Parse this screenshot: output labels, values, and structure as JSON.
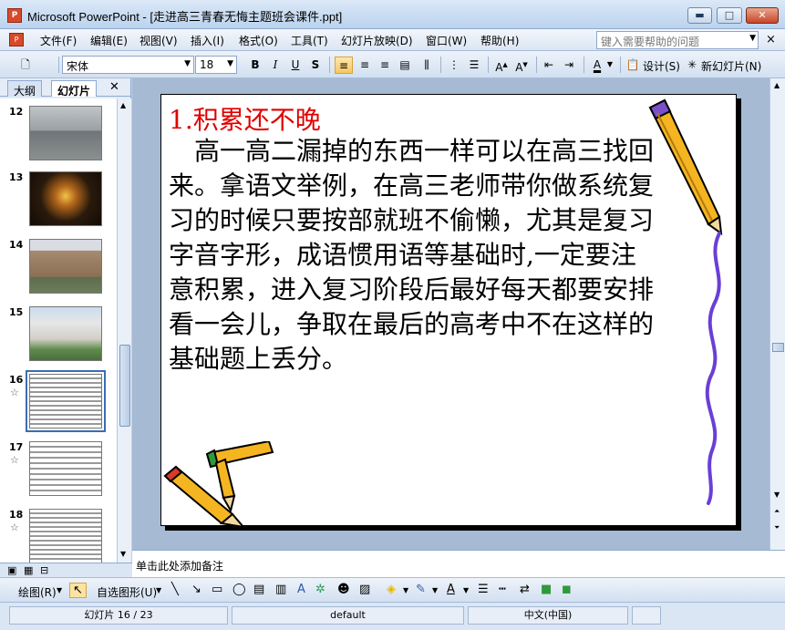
{
  "window": {
    "title": "Microsoft PowerPoint - [走进高三青春无悔主题班会课件.ppt]",
    "app_icon_letter": "P",
    "minimize": "▬",
    "maximize": "□",
    "close": "✕"
  },
  "menu": {
    "items": [
      "文件(F)",
      "编辑(E)",
      "视图(V)",
      "插入(I)",
      "格式(O)",
      "工具(T)",
      "幻灯片放映(D)",
      "窗口(W)",
      "帮助(H)"
    ],
    "help_placeholder": "键入需要帮助的问题",
    "doc_close": "×"
  },
  "format_toolbar": {
    "font_name": "宋体",
    "font_size": "18",
    "bold": "B",
    "italic": "I",
    "underline": "U",
    "shadow": "S",
    "design_label": "设计(S)",
    "new_slide_label": "新幻灯片(N)"
  },
  "left_pane": {
    "tabs": [
      "大纲",
      "幻灯片"
    ],
    "active_tab": "幻灯片",
    "close": "✕",
    "thumbnails": [
      {
        "number": "12",
        "star": "",
        "kind": "photo-gate"
      },
      {
        "number": "13",
        "star": "",
        "kind": "photo-night"
      },
      {
        "number": "14",
        "star": "",
        "kind": "photo-building"
      },
      {
        "number": "15",
        "star": "",
        "kind": "photo-campus"
      },
      {
        "number": "16",
        "star": "☆",
        "kind": "text-slide",
        "selected": true
      },
      {
        "number": "17",
        "star": "☆",
        "kind": "text-slide"
      },
      {
        "number": "18",
        "star": "☆",
        "kind": "text-slide"
      }
    ]
  },
  "slide": {
    "heading": "1.积累还不晚",
    "body": "　高一高二漏掉的东西一样可以在高三找回来。拿语文举例，在高三老师带你做系统复习的时候只要按部就班不偷懒，尤其是复习字音字形，成语惯用语等基础时,一定要注意积累，进入复习阶段后最好每天都要安排看一会儿，争取在最后的高考中不在这样的基础题上丢分。"
  },
  "notes": {
    "placeholder": "单击此处添加备注"
  },
  "draw_toolbar": {
    "draw_label": "绘图(R)",
    "autoshape_label": "自选图形(U)"
  },
  "status": {
    "slide_position": "幻灯片 16 / 23",
    "design": "default",
    "language": "中文(中国)"
  },
  "colors": {
    "heading": "#e00000",
    "accent": "#3a6cb4",
    "pencil_yellow": "#f4b521",
    "squiggle": "#6a3fd6"
  }
}
